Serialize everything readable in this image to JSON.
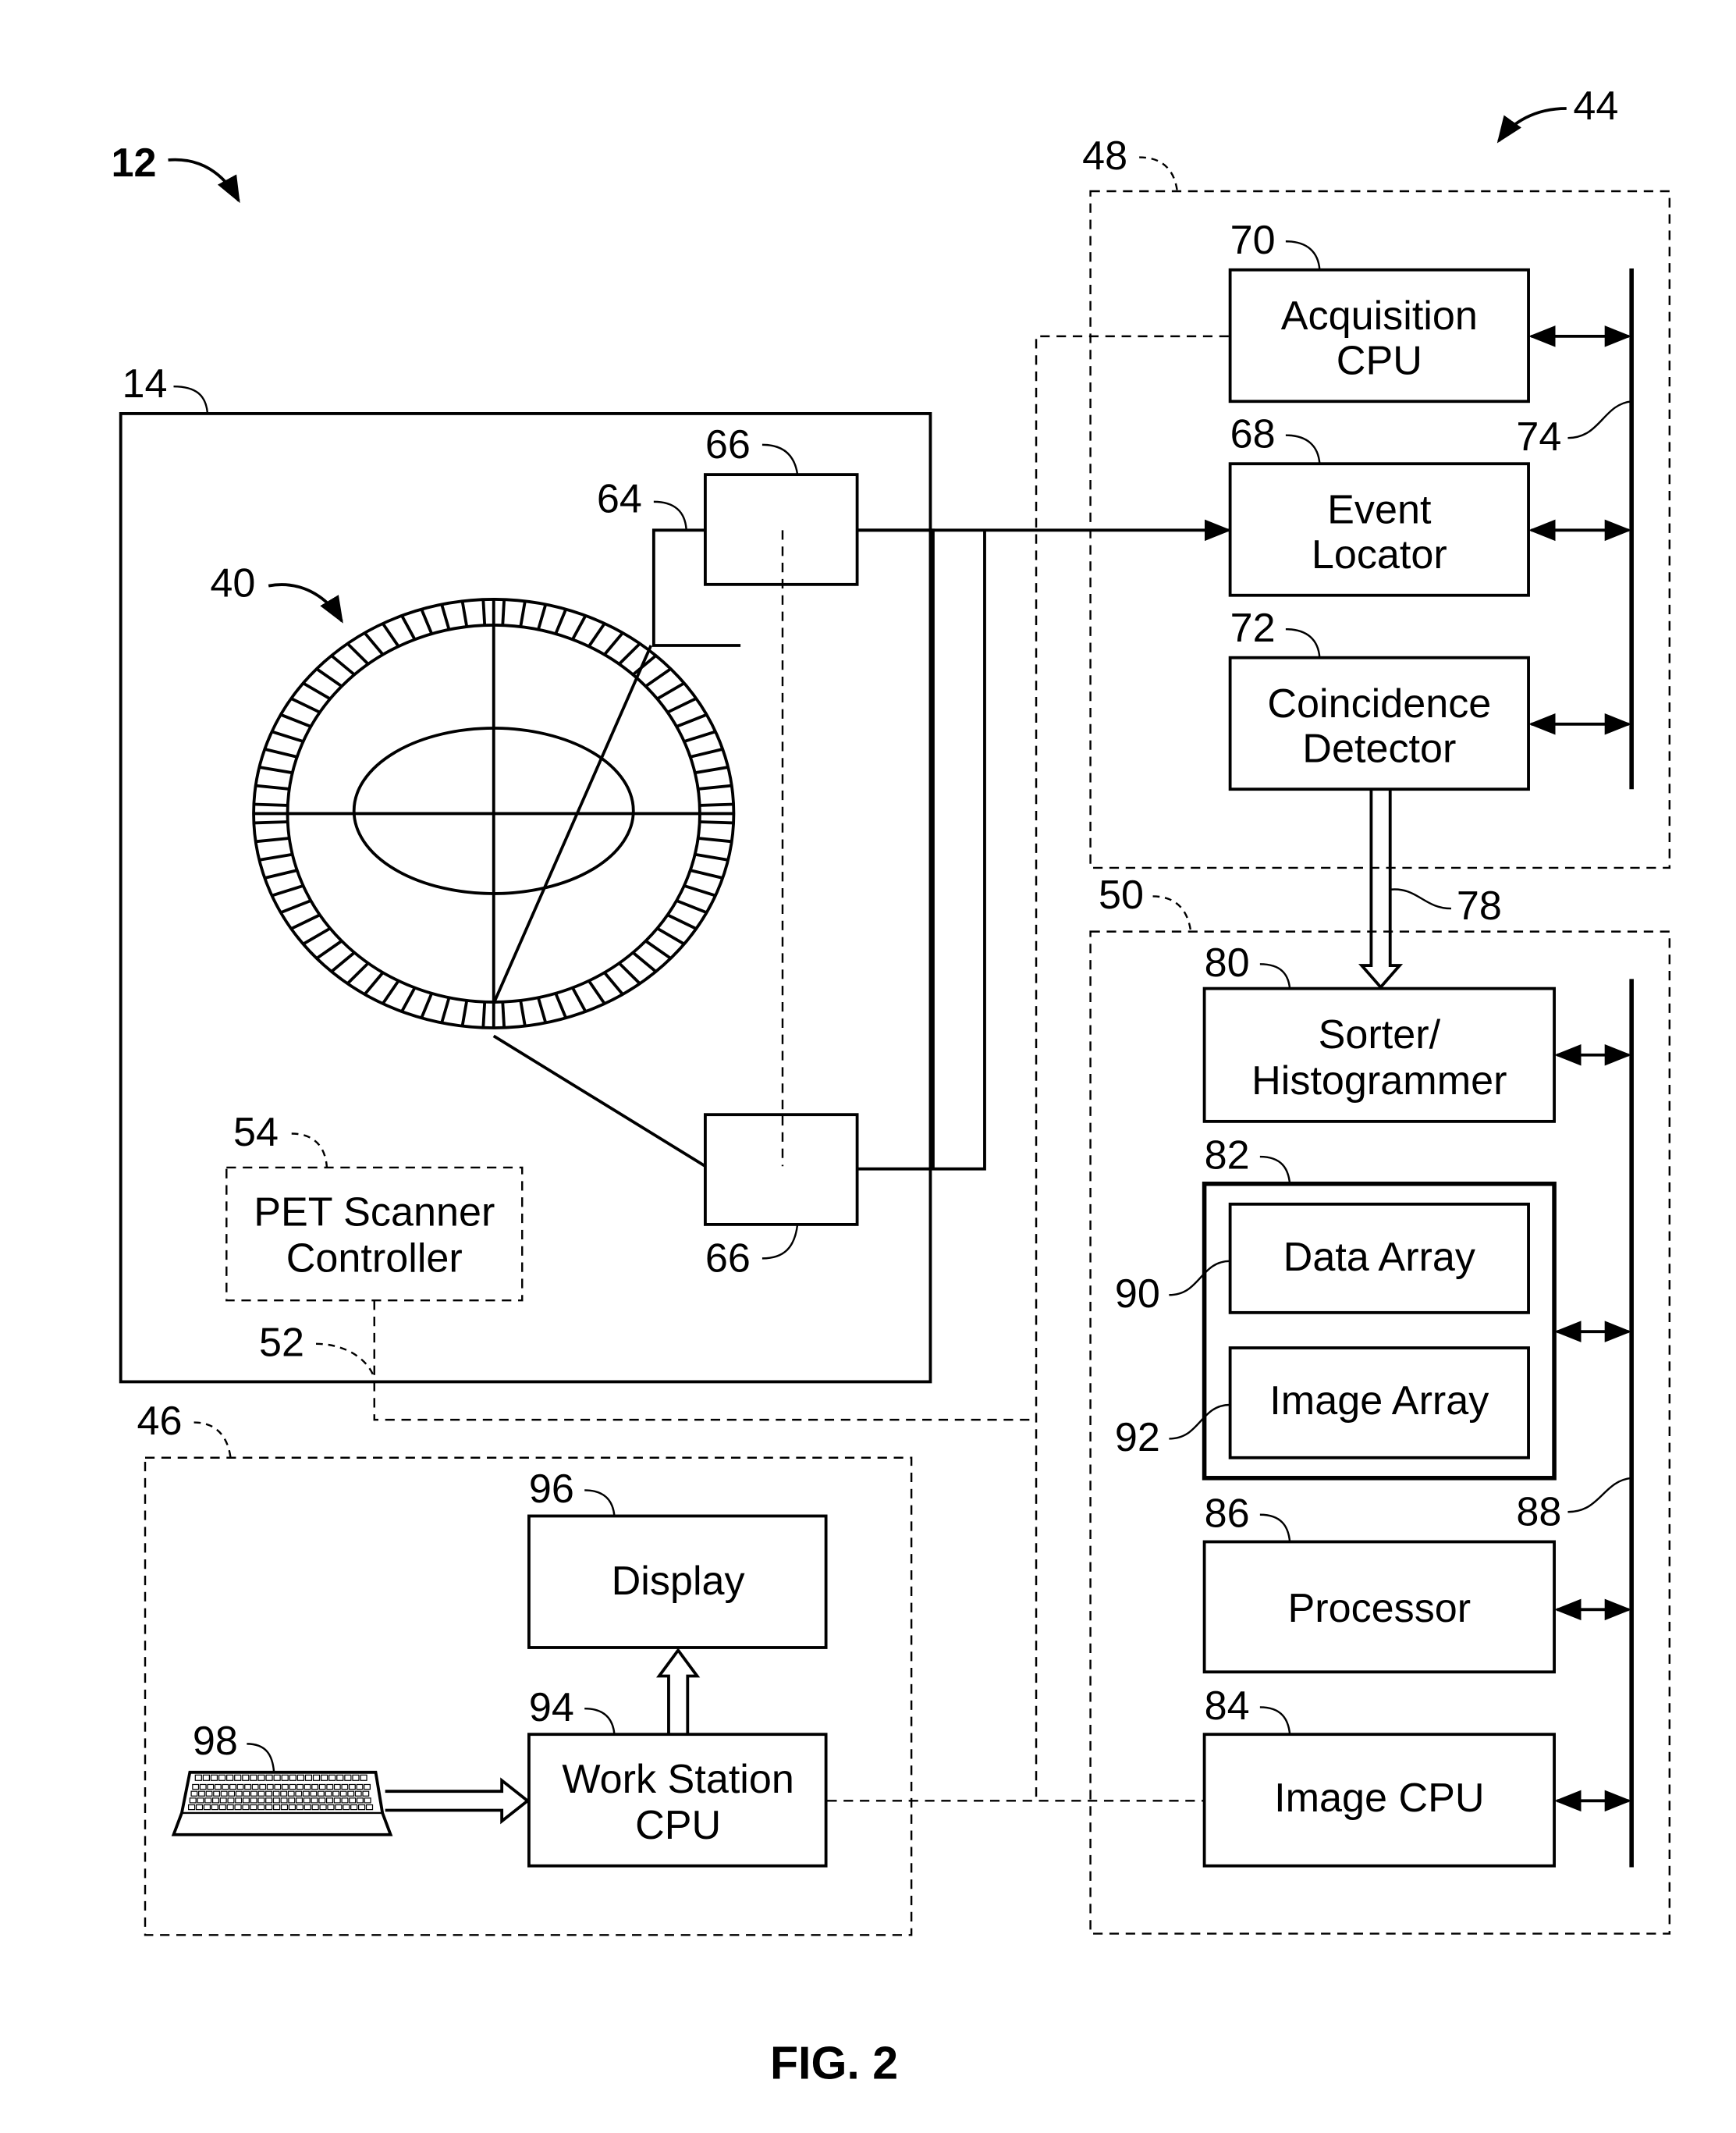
{
  "figure": {
    "caption": "FIG. 2",
    "system_ref": "12",
    "controller_ref": "44"
  },
  "scanner": {
    "ref": "14",
    "ring_ref": "40",
    "detector_ring_segments": 72,
    "upper_module_ref": "66",
    "lower_module_ref": "66",
    "link_ref": "64",
    "controller": {
      "ref": "54",
      "label_lines": [
        "PET Scanner",
        "Controller"
      ]
    },
    "controller_link_ref": "52"
  },
  "acquisition_group": {
    "ref": "48",
    "bus_ref": "74",
    "blocks": [
      {
        "id": "acquisition-cpu",
        "ref": "70",
        "label_lines": [
          "Acquisition",
          "CPU"
        ]
      },
      {
        "id": "event-locator",
        "ref": "68",
        "label_lines": [
          "Event",
          "Locator"
        ]
      },
      {
        "id": "coincidence-detector",
        "ref": "72",
        "label_lines": [
          "Coincidence",
          "Detector"
        ]
      }
    ]
  },
  "data_link_ref": "78",
  "image_group": {
    "ref": "50",
    "bus_ref": "88",
    "blocks": [
      {
        "id": "sorter-histogrammer",
        "ref": "80",
        "label_lines": [
          "Sorter/",
          "Histogrammer"
        ]
      },
      {
        "id": "memory",
        "ref": "82",
        "label_lines": []
      },
      {
        "id": "data-array",
        "ref": "90",
        "label_lines": [
          "Data Array"
        ]
      },
      {
        "id": "image-array",
        "ref": "92",
        "label_lines": [
          "Image Array"
        ]
      },
      {
        "id": "processor",
        "ref": "86",
        "label_lines": [
          "Processor"
        ]
      },
      {
        "id": "image-cpu",
        "ref": "84",
        "label_lines": [
          "Image CPU"
        ]
      }
    ]
  },
  "workstation_group": {
    "ref": "46",
    "blocks": [
      {
        "id": "display",
        "ref": "96",
        "label_lines": [
          "Display"
        ]
      },
      {
        "id": "workstation-cpu",
        "ref": "94",
        "label_lines": [
          "Work Station",
          "CPU"
        ]
      },
      {
        "id": "keyboard",
        "ref": "98",
        "label_lines": []
      }
    ]
  }
}
